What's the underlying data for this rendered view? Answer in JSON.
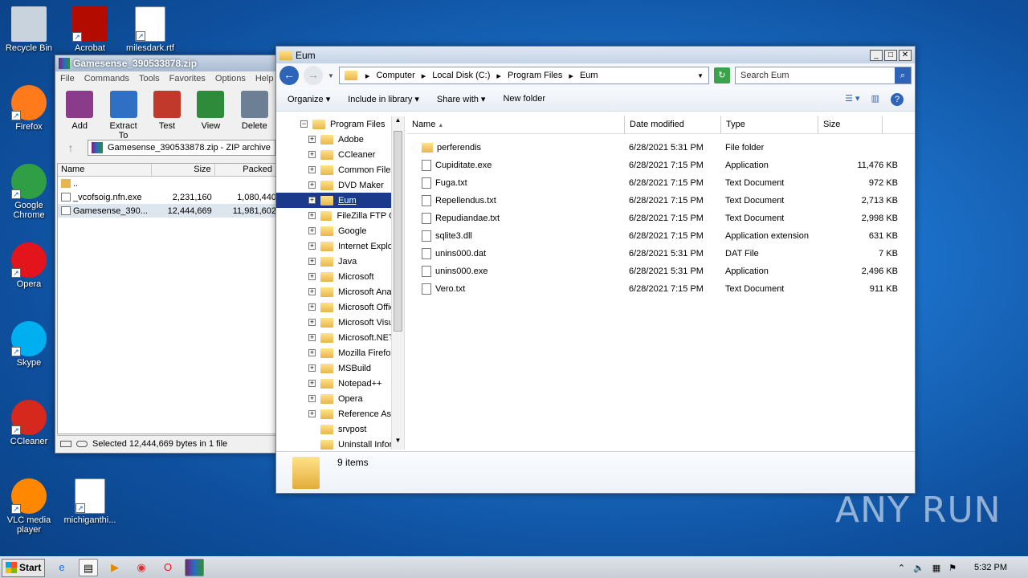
{
  "desktop": {
    "icons": [
      {
        "label": "Recycle Bin",
        "icon": "recycle-bin-icon"
      },
      {
        "label": "Acrobat",
        "icon": "acrobat-icon"
      },
      {
        "label": "milesdark.rtf",
        "icon": "word-doc-icon"
      },
      {
        "label": "Firefox",
        "icon": "firefox-icon"
      },
      {
        "label": "Google Chrome",
        "icon": "chrome-icon"
      },
      {
        "label": "Opera",
        "icon": "opera-icon"
      },
      {
        "label": "Skype",
        "icon": "skype-icon"
      },
      {
        "label": "CCleaner",
        "icon": "ccleaner-icon"
      },
      {
        "label": "VLC media player",
        "icon": "vlc-icon"
      },
      {
        "label": "michiganthi...",
        "icon": "word-doc-icon"
      }
    ]
  },
  "winrar": {
    "title": "Gamesense_390533878.zip",
    "menu": [
      "File",
      "Commands",
      "Tools",
      "Favorites",
      "Options",
      "Help"
    ],
    "tools": [
      "Add",
      "Extract To",
      "Test",
      "View",
      "Delete"
    ],
    "path": "Gamesense_390533878.zip - ZIP archive",
    "columns": [
      "Name",
      "Size",
      "Packed"
    ],
    "rows": [
      {
        "name": "..",
        "size": "",
        "packed": ""
      },
      {
        "name": "_vcofsoig.nfn.exe",
        "size": "2,231,160",
        "packed": "1,080,440"
      },
      {
        "name": "Gamesense_390...",
        "size": "12,444,669",
        "packed": "11,981,602"
      }
    ],
    "status": "Selected 12,444,669 bytes in 1 file"
  },
  "explorer": {
    "title": "Eum",
    "breadcrumb": [
      "Computer",
      "Local Disk (C:)",
      "Program Files",
      "Eum"
    ],
    "search_placeholder": "Search Eum",
    "commands": [
      "Organize",
      "Include in library",
      "Share with",
      "New folder"
    ],
    "tree": [
      {
        "label": "Program Files",
        "expand": "−",
        "indent": 0
      },
      {
        "label": "Adobe",
        "expand": "+",
        "indent": 1
      },
      {
        "label": "CCleaner",
        "expand": "+",
        "indent": 1
      },
      {
        "label": "Common Files",
        "expand": "+",
        "indent": 1
      },
      {
        "label": "DVD Maker",
        "expand": "+",
        "indent": 1
      },
      {
        "label": "Eum",
        "expand": "+",
        "indent": 1,
        "selected": true
      },
      {
        "label": "FileZilla FTP Clie",
        "expand": "+",
        "indent": 1
      },
      {
        "label": "Google",
        "expand": "+",
        "indent": 1
      },
      {
        "label": "Internet Explor",
        "expand": "+",
        "indent": 1
      },
      {
        "label": "Java",
        "expand": "+",
        "indent": 1
      },
      {
        "label": "Microsoft",
        "expand": "+",
        "indent": 1
      },
      {
        "label": "Microsoft Analy",
        "expand": "+",
        "indent": 1
      },
      {
        "label": "Microsoft Offic",
        "expand": "+",
        "indent": 1
      },
      {
        "label": "Microsoft Visua",
        "expand": "+",
        "indent": 1
      },
      {
        "label": "Microsoft.NET",
        "expand": "+",
        "indent": 1
      },
      {
        "label": "Mozilla Firefox",
        "expand": "+",
        "indent": 1
      },
      {
        "label": "MSBuild",
        "expand": "+",
        "indent": 1
      },
      {
        "label": "Notepad++",
        "expand": "+",
        "indent": 1
      },
      {
        "label": "Opera",
        "expand": "+",
        "indent": 1
      },
      {
        "label": "Reference Ass",
        "expand": "+",
        "indent": 1
      },
      {
        "label": "srvpost",
        "expand": "",
        "indent": 1
      },
      {
        "label": "Uninstall Inforr",
        "expand": "",
        "indent": 1
      }
    ],
    "columns": [
      "Name",
      "Date modified",
      "Type",
      "Size"
    ],
    "files": [
      {
        "name": "perferendis",
        "date": "6/28/2021 5:31 PM",
        "type": "File folder",
        "size": "",
        "icon": "folder"
      },
      {
        "name": "Cupiditate.exe",
        "date": "6/28/2021 7:15 PM",
        "type": "Application",
        "size": "11,476 KB",
        "icon": "exe"
      },
      {
        "name": "Fuga.txt",
        "date": "6/28/2021 7:15 PM",
        "type": "Text Document",
        "size": "972 KB",
        "icon": "txt"
      },
      {
        "name": "Repellendus.txt",
        "date": "6/28/2021 7:15 PM",
        "type": "Text Document",
        "size": "2,713 KB",
        "icon": "txt"
      },
      {
        "name": "Repudiandae.txt",
        "date": "6/28/2021 7:15 PM",
        "type": "Text Document",
        "size": "2,998 KB",
        "icon": "txt"
      },
      {
        "name": "sqlite3.dll",
        "date": "6/28/2021 7:15 PM",
        "type": "Application extension",
        "size": "631 KB",
        "icon": "dll"
      },
      {
        "name": "unins000.dat",
        "date": "6/28/2021 5:31 PM",
        "type": "DAT File",
        "size": "7 KB",
        "icon": "dat"
      },
      {
        "name": "unins000.exe",
        "date": "6/28/2021 5:31 PM",
        "type": "Application",
        "size": "2,496 KB",
        "icon": "exe"
      },
      {
        "name": "Vero.txt",
        "date": "6/28/2021 7:15 PM",
        "type": "Text Document",
        "size": "911 KB",
        "icon": "txt"
      }
    ],
    "item_count": "9 items"
  },
  "taskbar": {
    "start_label": "Start",
    "clock": "5:32 PM"
  },
  "watermark": "ANY RUN"
}
